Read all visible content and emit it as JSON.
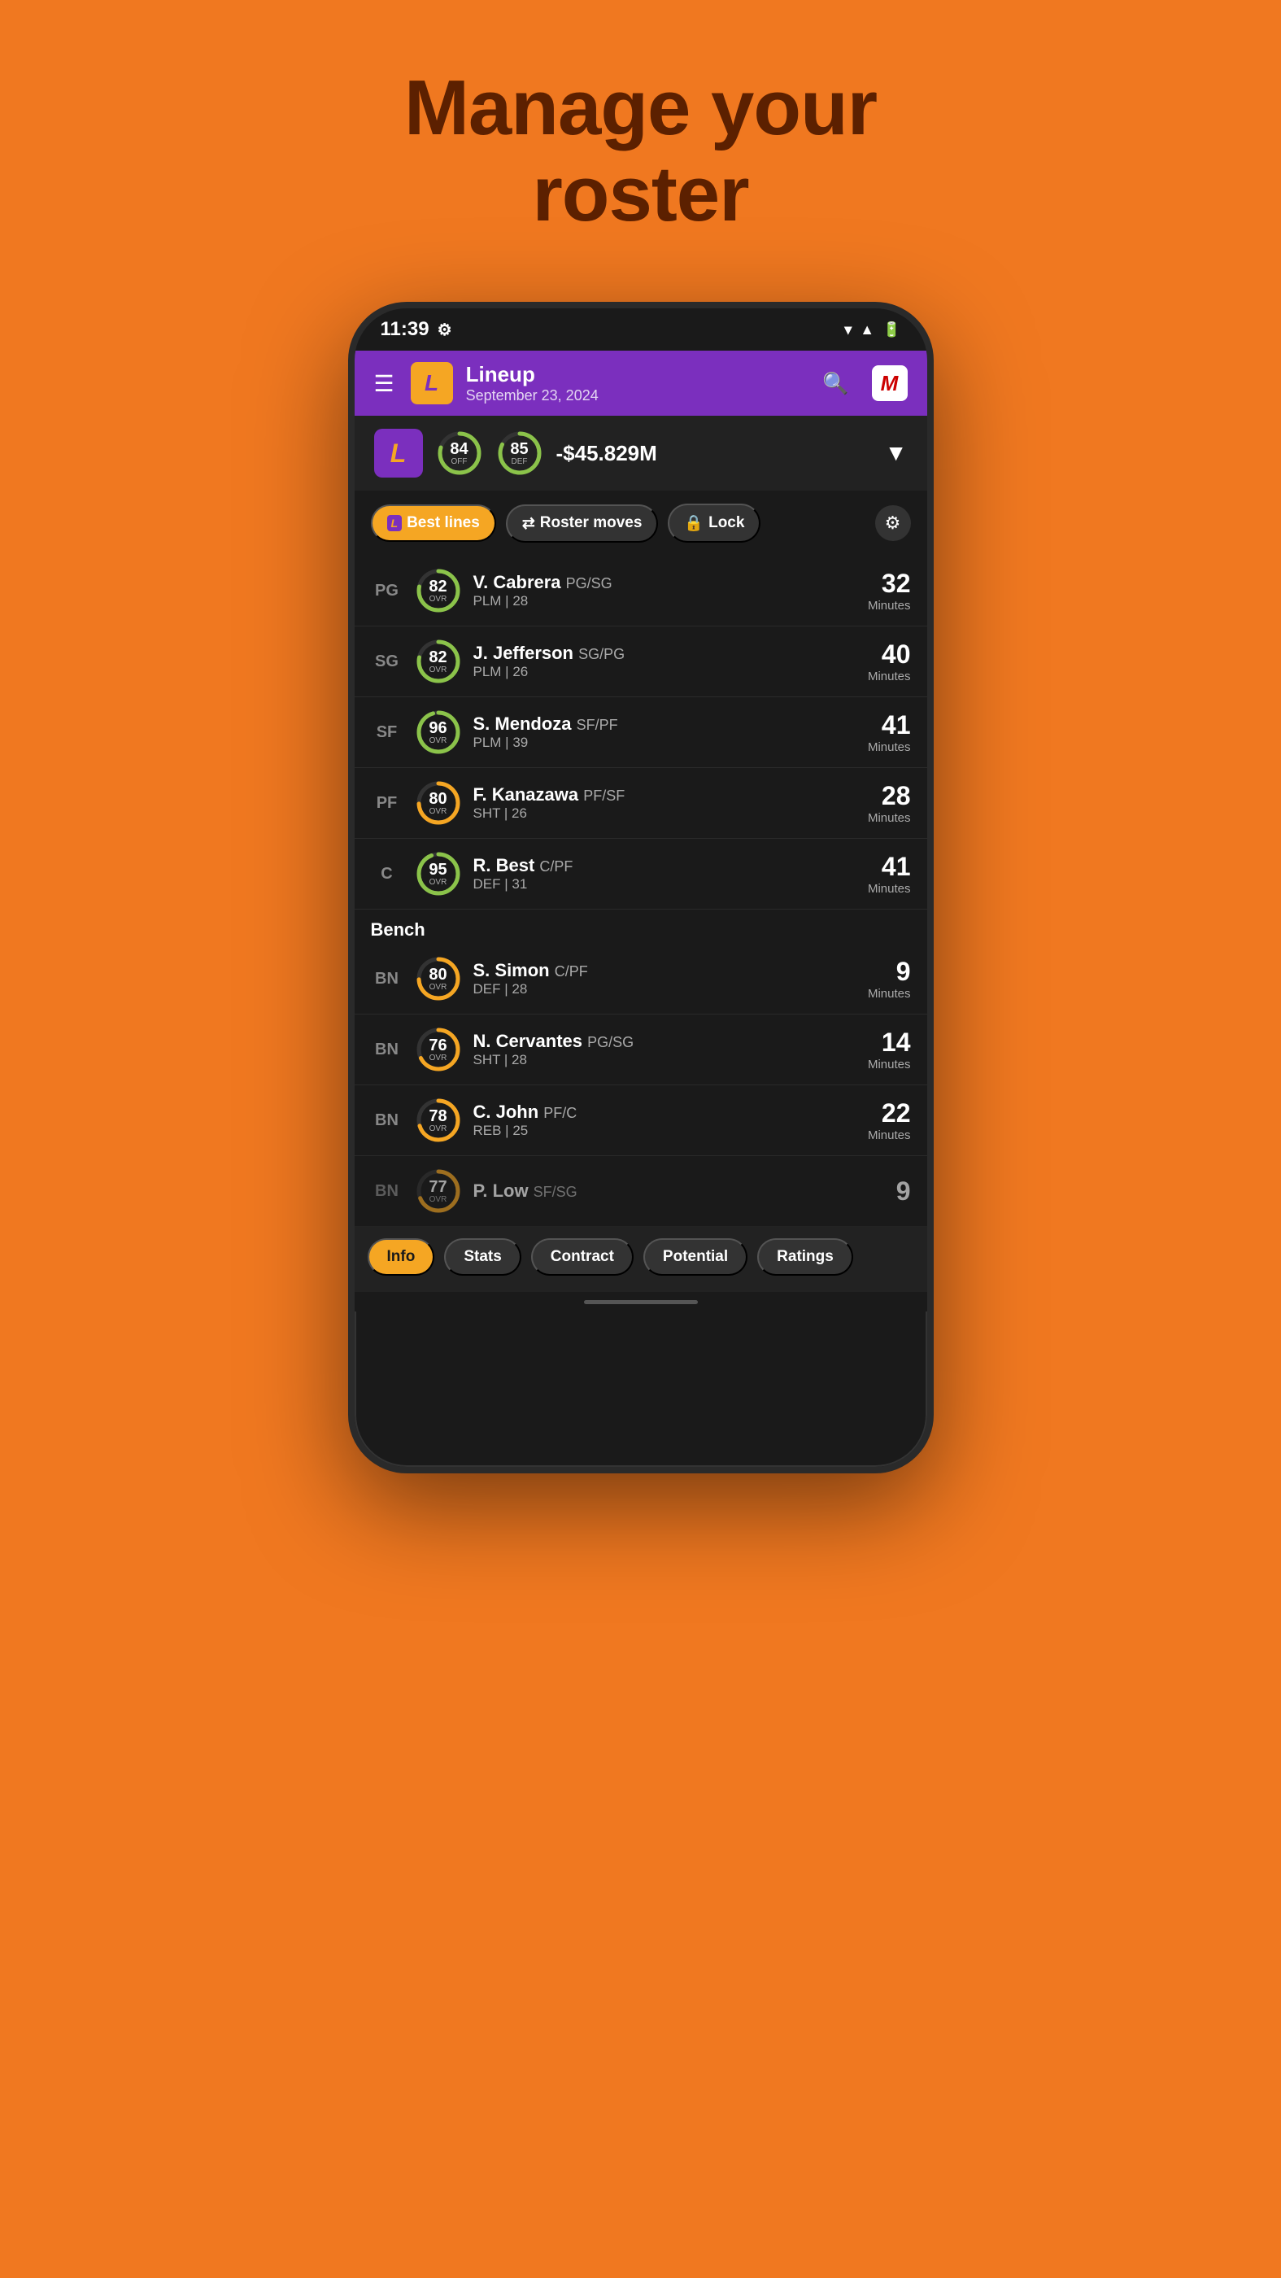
{
  "page": {
    "title_line1": "Manage your",
    "title_line2": "roster"
  },
  "status_bar": {
    "time": "11:39",
    "icons": [
      "gear",
      "wifi",
      "signal",
      "battery"
    ]
  },
  "header": {
    "menu_icon": "☰",
    "logo_letter": "L",
    "title": "Lineup",
    "date": "September 23, 2024",
    "search_icon": "🔍",
    "avatar_letter": "M"
  },
  "team_summary": {
    "logo_letter": "L",
    "off_rating": 84,
    "off_label": "OFF",
    "def_rating": 85,
    "def_label": "DEF",
    "budget": "-$45.829M",
    "chevron": "▼"
  },
  "action_buttons": {
    "best_lines": "Best lines",
    "roster_moves": "Roster moves",
    "lock": "Lock",
    "settings": "⚙"
  },
  "players": [
    {
      "position": "PG",
      "rating": 82,
      "name": "V. Cabrera",
      "pos_detail": "PG/SG",
      "sub": "PLM | 28",
      "minutes": 32,
      "ring_color": "#8BC34A"
    },
    {
      "position": "SG",
      "rating": 82,
      "name": "J. Jefferson",
      "pos_detail": "SG/PG",
      "sub": "PLM | 26",
      "minutes": 40,
      "ring_color": "#8BC34A"
    },
    {
      "position": "SF",
      "rating": 96,
      "name": "S. Mendoza",
      "pos_detail": "SF/PF",
      "sub": "PLM | 39",
      "minutes": 41,
      "ring_color": "#8BC34A"
    },
    {
      "position": "PF",
      "rating": 80,
      "name": "F. Kanazawa",
      "pos_detail": "PF/SF",
      "sub": "SHT | 26",
      "minutes": 28,
      "ring_color": "#F5A623"
    },
    {
      "position": "C",
      "rating": 95,
      "name": "R. Best",
      "pos_detail": "C/PF",
      "sub": "DEF | 31",
      "minutes": 41,
      "ring_color": "#8BC34A"
    }
  ],
  "bench_label": "Bench",
  "bench_players": [
    {
      "position": "BN",
      "rating": 80,
      "name": "S. Simon",
      "pos_detail": "C/PF",
      "sub": "DEF | 28",
      "minutes": 9,
      "ring_color": "#F5A623"
    },
    {
      "position": "BN",
      "rating": 76,
      "name": "N. Cervantes",
      "pos_detail": "PG/SG",
      "sub": "SHT | 28",
      "minutes": 14,
      "ring_color": "#F5A623"
    },
    {
      "position": "BN",
      "rating": 78,
      "name": "C. John",
      "pos_detail": "PF/C",
      "sub": "REB | 25",
      "minutes": 22,
      "ring_color": "#F5A623"
    },
    {
      "position": "BN",
      "rating": 77,
      "name": "P. Low",
      "pos_detail": "SF/SG",
      "sub": "",
      "minutes": 9,
      "ring_color": "#F5A623"
    }
  ],
  "bottom_nav": {
    "tabs": [
      "Info",
      "Stats",
      "Contract",
      "Potential",
      "Ratings"
    ],
    "active": "Info"
  }
}
